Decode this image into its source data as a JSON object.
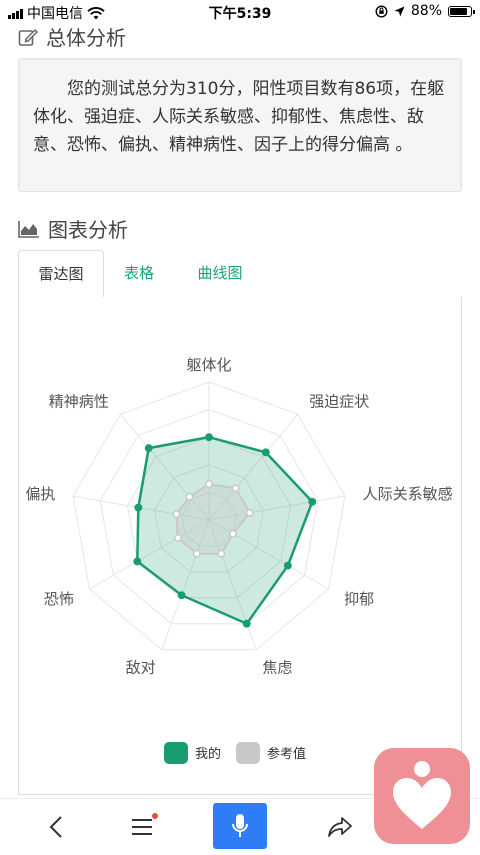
{
  "status_bar": {
    "carrier": "中国电信",
    "time": "下午5:39",
    "battery": "88%",
    "battery_level": 0.88
  },
  "summary_section": {
    "title": "总体分析",
    "icon": "edit-icon",
    "text": "您的测试总分为310分，阳性项目数有86项，在躯体化、强迫症、人际关系敏感、抑郁性、焦虑性、敌意、恐怖、偏执、精神病性、因子上的得分偏高 。"
  },
  "chart_section": {
    "title": "图表分析",
    "icon": "area-chart-icon",
    "tabs": [
      {
        "label": "雷达图",
        "active": true
      },
      {
        "label": "表格",
        "active": false
      },
      {
        "label": "曲线图",
        "active": false
      }
    ]
  },
  "chart_data": {
    "type": "radar",
    "indicators": [
      "躯体化",
      "强迫症状",
      "人际关系敏感",
      "抑郁",
      "焦虑",
      "敌对",
      "恐怖",
      "偏执",
      "精神病性"
    ],
    "max": 5,
    "levels": 5,
    "series": [
      {
        "name": "我的",
        "color": "#1a9b72",
        "fill": "rgba(26,155,114,0.22)",
        "values": [
          3.0,
          3.2,
          3.8,
          3.3,
          4.0,
          2.9,
          3.0,
          2.6,
          3.4
        ]
      },
      {
        "name": "参考值",
        "color": "#c8c8c8",
        "fill": "rgba(200,200,200,0.35)",
        "values": [
          1.3,
          1.5,
          1.5,
          1.0,
          1.3,
          1.3,
          1.3,
          1.2,
          1.1
        ]
      }
    ],
    "legend": [
      {
        "label": "我的",
        "color": "#1a9b72"
      },
      {
        "label": "参考值",
        "color": "#c8c8c8"
      }
    ]
  },
  "toolbar": {
    "items": [
      "back-icon",
      "menu-icon",
      "microphone-icon",
      "share-icon"
    ]
  }
}
